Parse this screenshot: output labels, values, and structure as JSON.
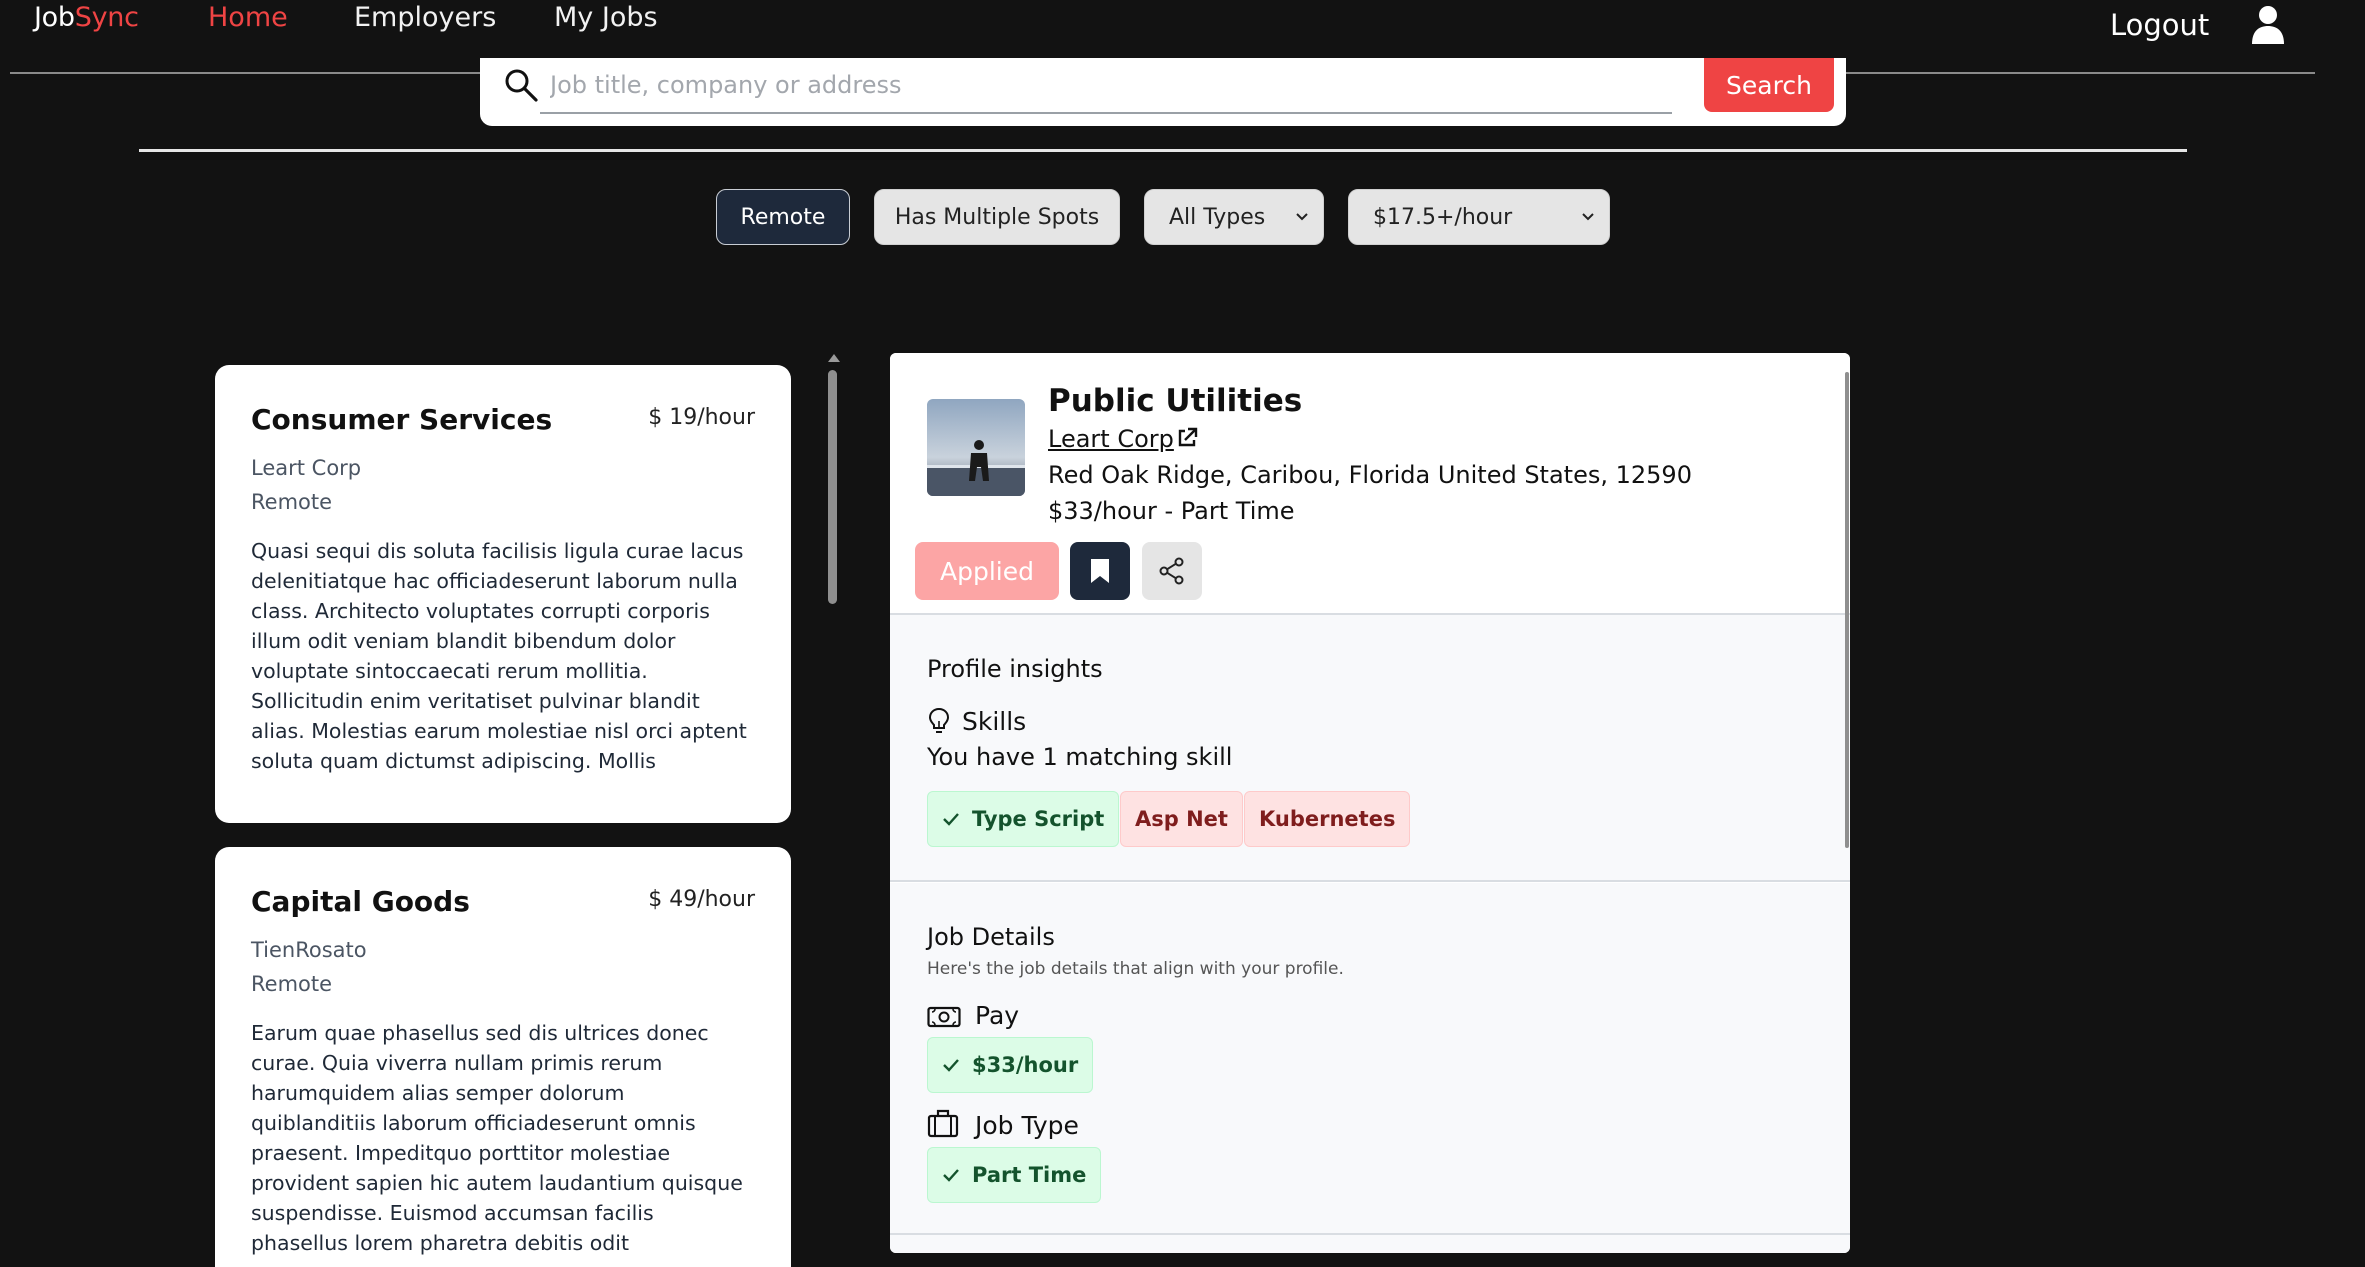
{
  "nav": {
    "logo_part1": "Job",
    "logo_part2": "Sync",
    "links": [
      "Home",
      "Employers",
      "My Jobs"
    ],
    "logout": "Logout"
  },
  "search": {
    "placeholder": "Job title, company or address",
    "value": "",
    "button": "Search"
  },
  "filters": {
    "remote": "Remote",
    "multiple_spots": "Has Multiple Spots",
    "type_selected": "All Types",
    "rate_selected": "$17.5+/hour"
  },
  "jobs": [
    {
      "title": "Consumer Services",
      "pay": "$ 19/hour",
      "company": "Leart Corp",
      "location": "Remote",
      "description": "Quasi sequi dis soluta facilisis ligula curae lacus delenitiatque hac officiadeserunt laborum nulla class. Architecto voluptates corrupti corporis illum odit veniam blandit bibendum dolor voluptate sintoccaecati rerum mollitia. Sollicitudin enim veritatiset pulvinar blandit alias. Molestias earum molestiae nisl orci aptent soluta quam dictumst adipiscing. Mollis"
    },
    {
      "title": "Capital Goods",
      "pay": "$ 49/hour",
      "company": "TienRosato",
      "location": "Remote",
      "description": "Earum quae phasellus sed dis ultrices donec curae. Quia viverra nullam primis rerum harumquidem alias semper dolorum quiblanditiis laborum officiadeserunt omnis praesent. Impeditquo porttitor molestiae provident sapien hic autem laudantium quisque suspendisse. Euismod accumsan facilis phasellus lorem pharetra debitis odit"
    }
  ],
  "detail": {
    "title": "Public Utilities",
    "company": "Leart Corp",
    "address": "Red Oak Ridge, Caribou, Florida United States, 12590",
    "pay_type": "$33/hour - Part Time",
    "applied_label": "Applied",
    "insights": {
      "heading": "Profile insights",
      "skills_label": "Skills",
      "skills_summary": "You have 1 matching skill",
      "skills": [
        {
          "name": "Type Script",
          "matched": true
        },
        {
          "name": "Asp Net",
          "matched": false
        },
        {
          "name": "Kubernetes",
          "matched": false
        }
      ]
    },
    "job_details": {
      "heading": "Job Details",
      "subheading": "Here's the job details that align with your profile.",
      "pay_label": "Pay",
      "pay_value": "$33/hour",
      "type_label": "Job Type",
      "type_value": "Part Time"
    }
  },
  "icons": {
    "user": "user-icon",
    "search": "search-icon",
    "external": "external-link-icon",
    "bookmark": "bookmark-icon",
    "share": "share-icon",
    "lightbulb": "lightbulb-icon",
    "money": "money-icon",
    "briefcase": "briefcase-icon",
    "check": "check-icon"
  },
  "colors": {
    "accent": "#ef4444",
    "dark": "#1e293b",
    "match_bg": "#dcfce7",
    "miss_bg": "#fee2e2"
  }
}
